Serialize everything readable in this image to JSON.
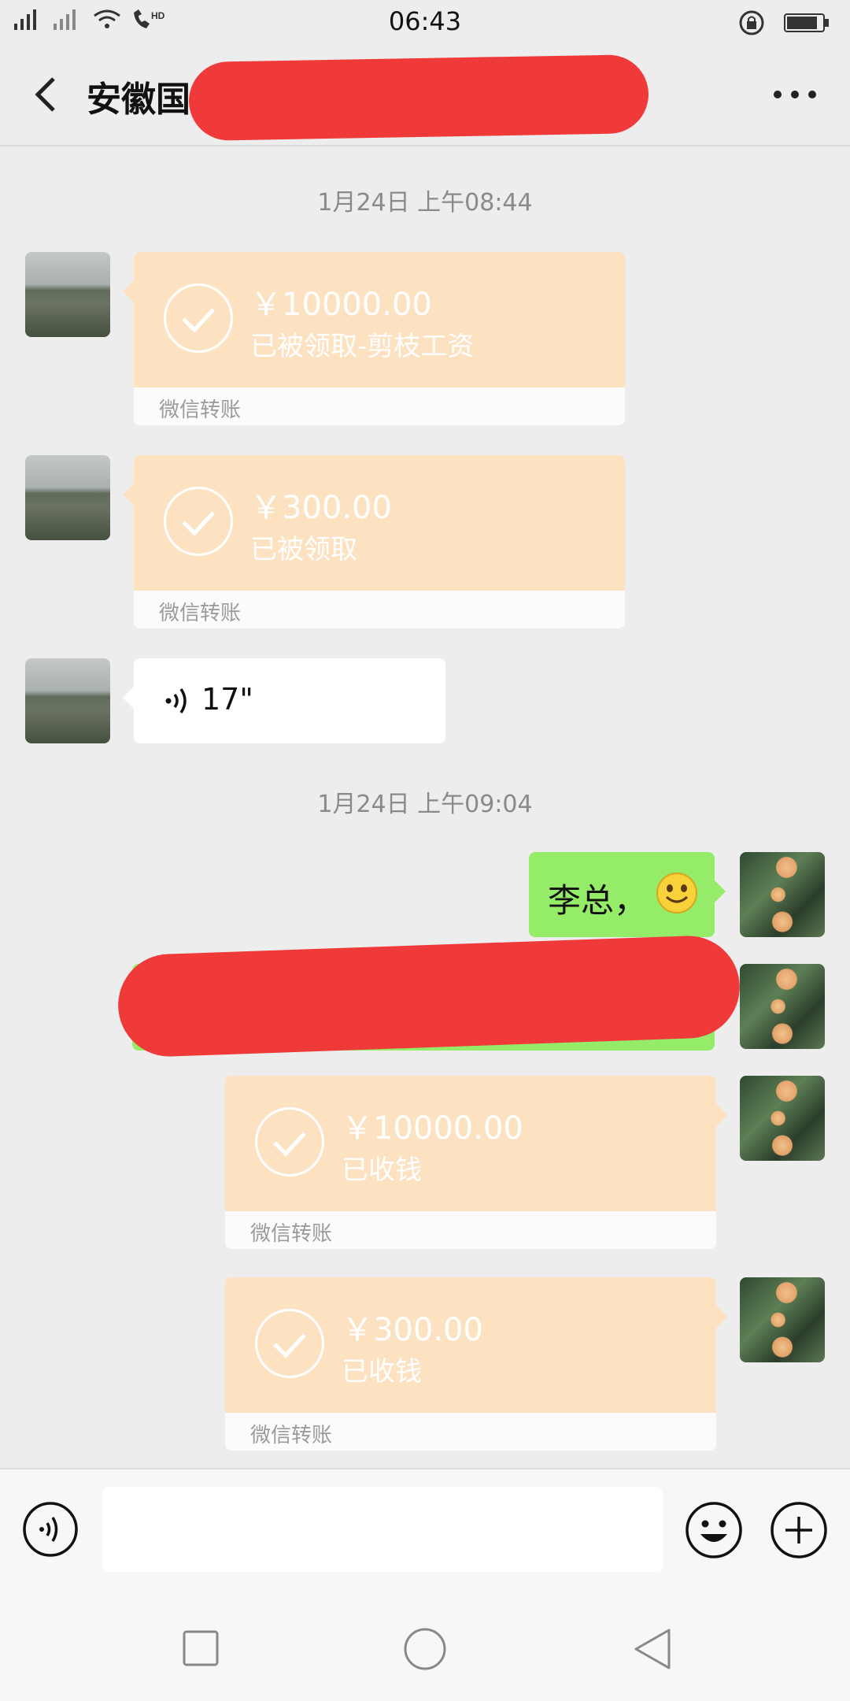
{
  "status_bar": {
    "network": "4G",
    "hd": "HD",
    "time": "06:43"
  },
  "header": {
    "title_visible": "安徽国",
    "back_icon": "chevron-left-icon",
    "more_icon": "more-dots-icon"
  },
  "messages": {
    "timestamp_1": "1月24日 上午08:44",
    "transfer_1": {
      "amount": "￥10000.00",
      "status": "已被领取-剪枝工资",
      "caption": "微信转账"
    },
    "transfer_2": {
      "amount": "￥300.00",
      "status": "已被领取",
      "caption": "微信转账"
    },
    "voice_1": {
      "duration": "17\""
    },
    "timestamp_2": "1月24日 上午09:04",
    "text_1": "李总，",
    "transfer_3": {
      "amount": "￥10000.00",
      "status": "已收钱",
      "caption": "微信转账"
    },
    "transfer_4": {
      "amount": "￥300.00",
      "status": "已收钱",
      "caption": "微信转账"
    }
  },
  "colors": {
    "transfer_bg": "#fde2c2",
    "sent_bubble": "#95ec69",
    "redaction": "#f03a3a",
    "chat_bg": "#ededed"
  }
}
